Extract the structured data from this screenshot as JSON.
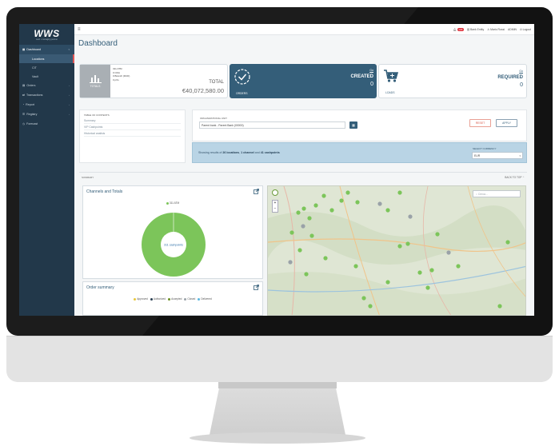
{
  "logo": {
    "name": "WWS",
    "tagline": "cash • managing partner"
  },
  "sidebar": {
    "items": [
      {
        "label": "Dashboard",
        "icon": "dashboard-icon",
        "active": true
      },
      {
        "label": "Orders",
        "icon": "orders-icon"
      },
      {
        "label": "Transactions",
        "icon": "transactions-icon"
      },
      {
        "label": "Report",
        "icon": "report-icon"
      },
      {
        "label": "Registry",
        "icon": "registry-icon"
      },
      {
        "label": "Forecast",
        "icon": "forecast-icon"
      }
    ],
    "subitems": [
      {
        "label": "Locations",
        "selected": true
      },
      {
        "label": "CIT"
      },
      {
        "label": "Vault"
      }
    ]
  },
  "topbar": {
    "notifications": "123",
    "entity": "Bank Entity",
    "user": "Mario Rossi",
    "role": "ADMIN",
    "logout": "Logout"
  },
  "page": {
    "title": "Dashboard"
  },
  "cards": {
    "totals": {
      "icon_label": "TOTALS",
      "lines": [
        "311 ATM",
        "0 CDA",
        "0 Branch (DCD)",
        "0 pXs"
      ],
      "label": "TOTAL",
      "amount": "€40,072,580.00"
    },
    "orders": {
      "sub": "ORDERS",
      "go": "Go",
      "status": "CREATED",
      "count": "0"
    },
    "loads": {
      "sub": "LOADS",
      "go": "Go",
      "status": "REQUIRED",
      "count": "0"
    }
  },
  "toc": {
    "title": "TABLE OF CONTENTS",
    "items": [
      "Summary",
      "VIP Cashpoints",
      "Historical analisis"
    ]
  },
  "filter": {
    "label": "ORGANIZATIONAL UNIT",
    "value": "Parent bank - Parent Bank (00000)",
    "reset": "RESET",
    "apply": "APPLY"
  },
  "info": {
    "prefix": "Showing results of",
    "locations": "26 locations",
    "sep1": ",",
    "channel": "1 channel",
    "and": "and",
    "cashpoints": "41 cashpoints",
    "currency_label": "SELECT CURRENCY",
    "currency": "EUR"
  },
  "summary": {
    "label": "SUMMARY",
    "back": "BACK TO TOP"
  },
  "channels_panel": {
    "title": "Channels and Totals",
    "legend": [
      {
        "label": "311 ATM",
        "color": "#7cc55a"
      }
    ],
    "center_label": "311 cashpoints"
  },
  "chart_data": {
    "type": "pie",
    "categories": [
      "311 ATM"
    ],
    "values": [
      311
    ],
    "title": "Channels and Totals"
  },
  "orders_panel": {
    "title": "Order summary",
    "legend": [
      {
        "label": "Approved",
        "color": "#e8c63a"
      },
      {
        "label": "Authorized",
        "color": "#2a3f52"
      },
      {
        "label": "Accepted",
        "color": "#6b8f23"
      },
      {
        "label": "Closed",
        "color": "#9aa2a8"
      },
      {
        "label": "Delivered",
        "color": "#5bb7e0"
      }
    ]
  },
  "map": {
    "search_placeholder": "Cerca..."
  },
  "colors": {
    "primary": "#345e79",
    "sidebar": "#22384a",
    "accent_green": "#7cc55a",
    "danger": "#d9594a"
  }
}
